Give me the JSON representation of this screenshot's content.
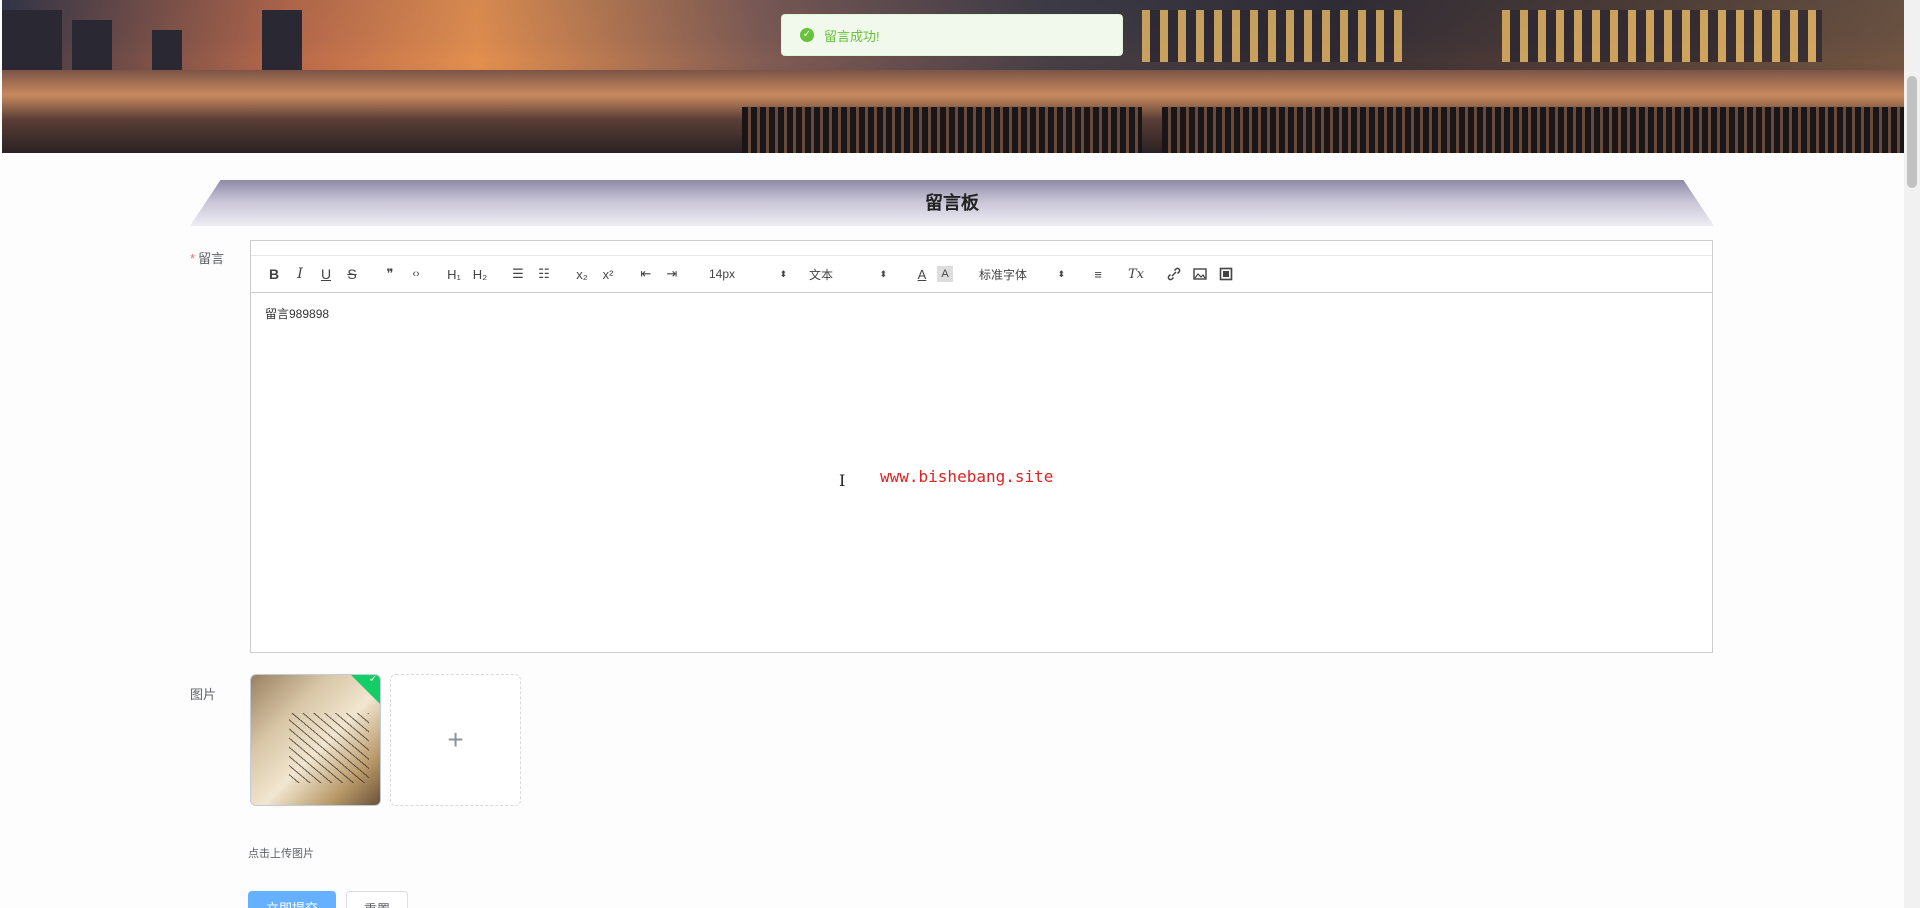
{
  "toast": {
    "message": "留言成功!",
    "icon": "success-check-icon"
  },
  "board": {
    "title": "留言板"
  },
  "form": {
    "message_label": "留言",
    "required_mark": "*",
    "image_label": "图片",
    "upload_tip": "点击上传图片",
    "submit_label": "立即提交",
    "reset_label": "重置"
  },
  "editor": {
    "toolbar": {
      "bold": "B",
      "italic": "I",
      "underline": "U",
      "strike": "S",
      "blockquote": "❞",
      "code": "‹›",
      "h1": "H₁",
      "h2": "H₂",
      "ordered_list": "☰",
      "bullet_list": "☷",
      "subscript": "x₂",
      "superscript": "x²",
      "outdent": "⇤",
      "indent": "⇥",
      "size_value": "14px",
      "header_value": "文本",
      "font_value": "标准字体",
      "color": "A",
      "background": "A",
      "align": "≡",
      "clean": "Tx"
    },
    "content": "留言989898"
  },
  "watermark": "www.bishebang.site",
  "colors": {
    "primary": "#409eff",
    "success": "#67c23a",
    "danger": "#f56c6c"
  }
}
